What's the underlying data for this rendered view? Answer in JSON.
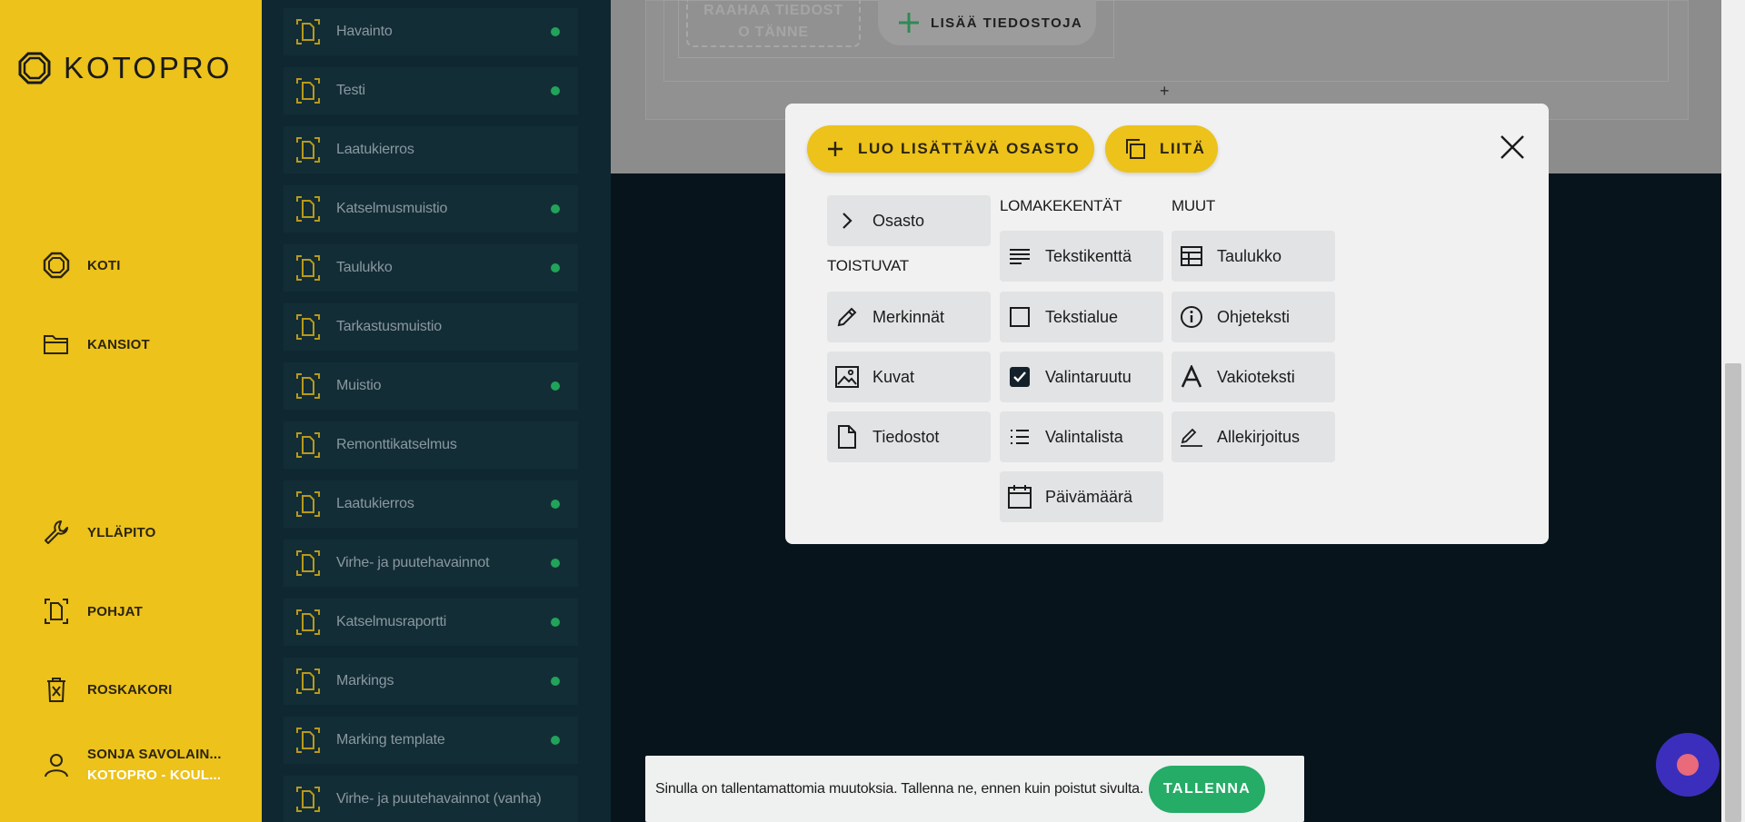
{
  "app": {
    "name": "KOTOPRO"
  },
  "sidebar": {
    "items": [
      {
        "label": "KOTI",
        "icon": "home-icon"
      },
      {
        "label": "KANSIOT",
        "icon": "folder-icon"
      },
      {
        "label": "YLLÄPITO",
        "icon": "wrench-icon"
      },
      {
        "label": "POHJAT",
        "icon": "template-icon"
      },
      {
        "label": "ROSKAKORI",
        "icon": "trash-icon"
      }
    ],
    "user": {
      "name": "SONJA SAVOLAIN...",
      "org": "KOTOPRO - KOUL..."
    }
  },
  "templates": [
    {
      "label": "Havainto",
      "active": true
    },
    {
      "label": "Testi",
      "active": true
    },
    {
      "label": "Laatukierros",
      "active": false
    },
    {
      "label": "Katselmusmuistio",
      "active": true
    },
    {
      "label": "Taulukko",
      "active": true
    },
    {
      "label": "Tarkastusmuistio",
      "active": false
    },
    {
      "label": "Muistio",
      "active": true
    },
    {
      "label": "Remonttikatselmus",
      "active": false
    },
    {
      "label": "Laatukierros",
      "active": true
    },
    {
      "label": "Virhe- ja puutehavainnot",
      "active": true
    },
    {
      "label": "Katselmusraportti",
      "active": true
    },
    {
      "label": "Markings",
      "active": true
    },
    {
      "label": "Marking template",
      "active": true
    },
    {
      "label": "Virhe- ja puutehavainnot (vanha)",
      "active": false
    }
  ],
  "editor": {
    "dropzone_text": "RAAHAA TIEDOSTO TÄNNE",
    "dropzone_line1": "RAAHAA TIEDOST",
    "dropzone_line2": "O TÄNNE",
    "add_files_label": "LISÄÄ TIEDOSTOJA",
    "add_section_symbol": "+"
  },
  "modal": {
    "create_section_label": "LUO LISÄTTÄVÄ OSASTO",
    "paste_label": "LIITÄ",
    "section_option": "Osasto",
    "columns": {
      "repeating": "TOISTUVAT",
      "form_fields": "LOMAKEKENTÄT",
      "other": "MUUT"
    },
    "repeating_options": [
      "Merkinnät",
      "Kuvat",
      "Tiedostot"
    ],
    "form_field_options": [
      "Tekstikenttä",
      "Tekstialue",
      "Valintaruutu",
      "Valintalista",
      "Päivämäärä"
    ],
    "other_options": [
      "Taulukko",
      "Ohjeteksti",
      "Vakioteksti",
      "Allekirjoitus"
    ]
  },
  "savebar": {
    "message": "Sinulla on tallentamattomia muutoksia. Tallenna ne, ennen kuin poistut sivulta.",
    "save_label": "TALLENNA"
  },
  "colors": {
    "brand_yellow": "#ecc21b",
    "list_bg": "#0f2730",
    "success_green": "#25ac67",
    "status_dot": "#21a35a",
    "chat_bubble": "#3b2ebd"
  }
}
